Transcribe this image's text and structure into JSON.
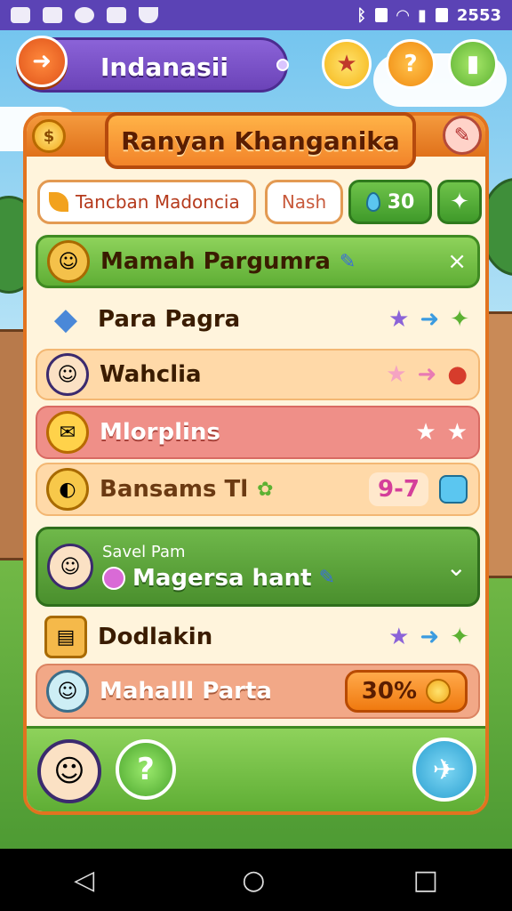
{
  "status_bar": {
    "time": "2553"
  },
  "header": {
    "title": "Indanasii",
    "help_icon_text": "?"
  },
  "panel": {
    "title": "Ranyan Khanganika",
    "tabs": [
      {
        "label": "Tancban Madoncia"
      },
      {
        "label": "Nash"
      },
      {
        "label": "30"
      }
    ]
  },
  "rows": [
    {
      "label": "Mamah Pargumra",
      "style": "green",
      "icon": "cookie-icon",
      "right": "×"
    },
    {
      "label": "Para Pagra",
      "style": "plain",
      "icon": "crystal-icon",
      "right": ""
    },
    {
      "label": "Wahclia",
      "style": "peach",
      "icon": "character-icon",
      "right": ""
    },
    {
      "label": "Mlorplins",
      "style": "red",
      "icon": "chat-bubble-icon",
      "right": ""
    },
    {
      "label": "Bansams Tl",
      "style": "peach",
      "icon": "coin-icon",
      "right": "9-7"
    },
    {
      "label": "Magersa hant",
      "subtitle": "Savel Pam",
      "style": "dark-green",
      "icon": "character-icon",
      "right": "⌄"
    },
    {
      "label": "Dodlakin",
      "style": "plain",
      "icon": "folder-icon",
      "right": ""
    },
    {
      "label": "Mahalll Parta",
      "style": "salmon",
      "icon": "ghost-icon",
      "right": "30%"
    }
  ],
  "bottom_bar": {
    "help_label": "?"
  },
  "colors": {
    "accent": "#e2731f",
    "green": "#5fae35",
    "purple": "#6b43b8"
  }
}
